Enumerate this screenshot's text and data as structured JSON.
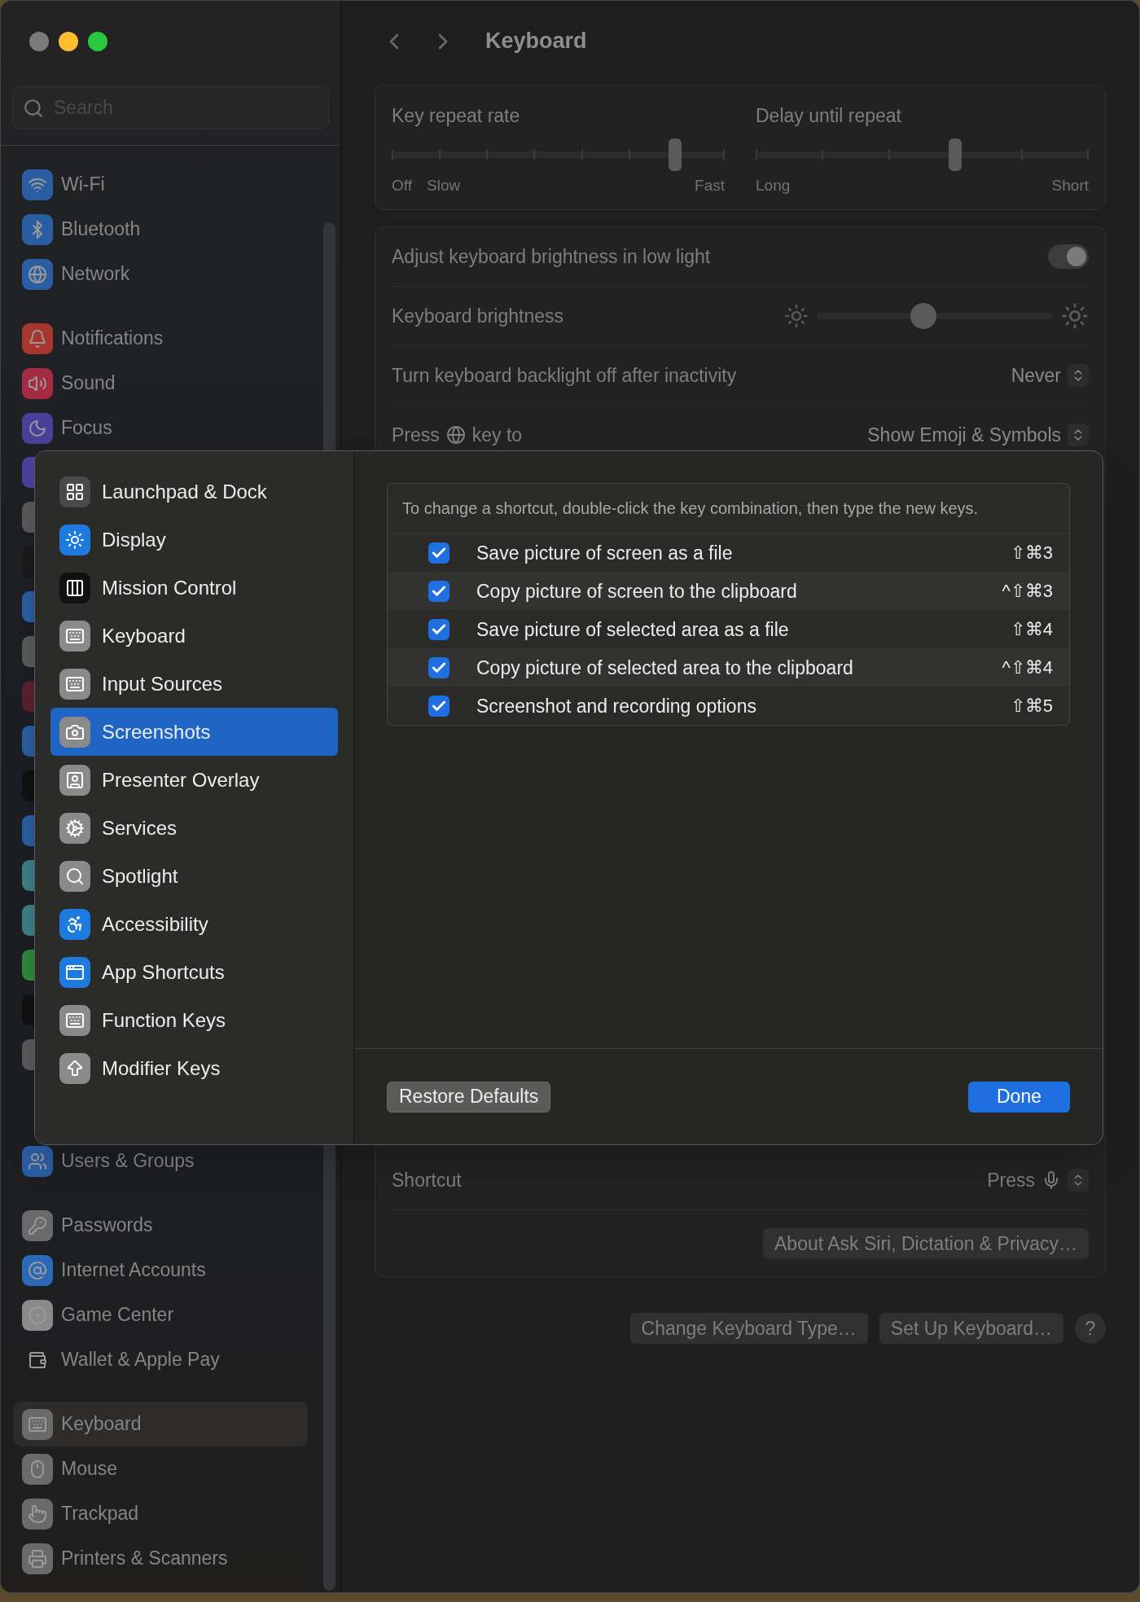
{
  "sidebar": {
    "search": {
      "placeholder": "Search"
    },
    "groups": [
      {
        "items": [
          {
            "label": "Wi-Fi",
            "selected": false,
            "color": "#2a5ea3"
          },
          {
            "label": "Bluetooth",
            "selected": false,
            "color": "#2a5ea3"
          },
          {
            "label": "Network",
            "selected": false,
            "color": "#2a5ea3"
          }
        ]
      },
      {
        "items": [
          {
            "label": "Notifications",
            "selected": false,
            "color": "#a8362e"
          },
          {
            "label": "Sound",
            "selected": false,
            "color": "#a52b42"
          },
          {
            "label": "Focus",
            "selected": false,
            "color": "#4b3f9c"
          }
        ]
      },
      {
        "items": [
          {
            "label": "Users & Groups",
            "selected": false,
            "color": "#2a5ea3"
          }
        ]
      },
      {
        "items": [
          {
            "label": "Passwords",
            "selected": false,
            "color": "#6a6a6a"
          },
          {
            "label": "Internet Accounts",
            "selected": false,
            "color": "#2a68b8"
          },
          {
            "label": "Game Center",
            "selected": false,
            "color": "#8a8a8a"
          },
          {
            "label": "Wallet & Apple Pay",
            "selected": false,
            "color": "#1e1e1e"
          }
        ]
      },
      {
        "items": [
          {
            "label": "Keyboard",
            "selected": true,
            "color": "#6a6a6a"
          },
          {
            "label": "Mouse",
            "selected": false,
            "color": "#6a6a6a"
          },
          {
            "label": "Trackpad",
            "selected": false,
            "color": "#6a6a6a"
          },
          {
            "label": "Printers & Scanners",
            "selected": false,
            "color": "#6a6a6a"
          }
        ]
      }
    ]
  },
  "main": {
    "title": "Keyboard",
    "sliders": [
      {
        "label": "Key repeat rate",
        "level": 0.85,
        "marks": [
          "Off",
          "Slow",
          "Fast"
        ]
      },
      {
        "label": "Delay until repeat",
        "level": 0.6,
        "marks": [
          "Long",
          "Short"
        ]
      }
    ],
    "settings": [
      {
        "kind": "toggle",
        "label": "Adjust keyboard brightness in low light",
        "on": true
      },
      {
        "kind": "slider",
        "label": "Keyboard brightness",
        "level": 0.45
      },
      {
        "kind": "popup",
        "label": "Turn keyboard backlight off after inactivity",
        "value": "Never"
      },
      {
        "kind": "globe",
        "label": "Press",
        "label_after": "key to",
        "value": "Show Emoji & Symbols"
      }
    ],
    "dictation": [
      {
        "kind": "mic",
        "label": "Shortcut",
        "value": "Press"
      }
    ],
    "about_button": "About Ask Siri, Dictation & Privacy…",
    "buttons": [
      "Change Keyboard Type…",
      "Set Up Keyboard…"
    ],
    "help": "?"
  },
  "sheet": {
    "sidebar": [
      {
        "label": "Launchpad & Dock",
        "selected": false
      },
      {
        "label": "Display",
        "selected": false
      },
      {
        "label": "Mission Control",
        "selected": false
      },
      {
        "label": "Keyboard",
        "selected": false
      },
      {
        "label": "Input Sources",
        "selected": false
      },
      {
        "label": "Screenshots",
        "selected": true
      },
      {
        "label": "Presenter Overlay",
        "selected": false
      },
      {
        "label": "Services",
        "selected": false
      },
      {
        "label": "Spotlight",
        "selected": false
      },
      {
        "label": "Accessibility",
        "selected": false
      },
      {
        "label": "App Shortcuts",
        "selected": false
      },
      {
        "label": "Function Keys",
        "selected": false
      },
      {
        "label": "Modifier Keys",
        "selected": false
      }
    ],
    "hint": "To change a shortcut, double-click the key combination, then type the new keys.",
    "shortcuts": [
      {
        "checked": true,
        "label": "Save picture of screen as a file",
        "keys": "⇧⌘3"
      },
      {
        "checked": true,
        "label": "Copy picture of screen to the clipboard",
        "keys": "^⇧⌘3"
      },
      {
        "checked": true,
        "label": "Save picture of selected area as a file",
        "keys": "⇧⌘4"
      },
      {
        "checked": true,
        "label": "Copy picture of selected area to the clipboard",
        "keys": "^⇧⌘4"
      },
      {
        "checked": true,
        "label": "Screenshot and recording options",
        "keys": "⇧⌘5"
      }
    ],
    "restore_button": "Restore Defaults",
    "done_button": "Done"
  }
}
